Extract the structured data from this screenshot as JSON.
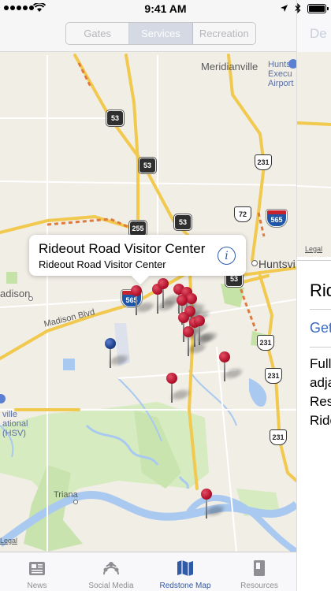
{
  "status_bar": {
    "time": "9:41 AM"
  },
  "segmented": {
    "items": [
      "Gates",
      "Services",
      "Recreation"
    ],
    "selected": "Services"
  },
  "nav": {
    "right_ghost": "De"
  },
  "map": {
    "labels": [
      "Meridianville",
      "Huntsville Executive Airport",
      "Huntsville",
      "Madison",
      "Madison Blvd",
      "Triana",
      "Huntsville International (HSV)"
    ],
    "label_fragments": {
      "huntsville_1": "Hunts",
      "huntsville_2": "Execu",
      "huntsville_3": "Airport",
      "huntsville_city": "Huntsvi",
      "madison": "adison",
      "hsv_1": "ville",
      "hsv_2": "ational",
      "hsv_3": "(HSV)"
    },
    "legal": "Legal",
    "shields": {
      "us53_a": "53",
      "us53_b": "53",
      "state255": "255",
      "state53": "53",
      "state53_b": "53",
      "us231_a": "231",
      "us231_b": "231",
      "us231_c": "231",
      "us231_d": "231",
      "us72": "72",
      "i565_a": "565",
      "i565_b": "565"
    }
  },
  "callout": {
    "title": "Rideout Road Visitor Center",
    "subtitle": "Rideout Road Visitor Center",
    "info_icon": "i"
  },
  "detail": {
    "legal": "Legal",
    "title": "Rid",
    "link": "Get",
    "text_lines": [
      "Full",
      "adja",
      "Res",
      "Ride"
    ]
  },
  "tabs": [
    {
      "label": "News",
      "icon": "news-icon"
    },
    {
      "label": "Social Media",
      "icon": "social-media-icon"
    },
    {
      "label": "Redstone Map",
      "icon": "map-icon",
      "active": true
    },
    {
      "label": "Resources",
      "icon": "resources-icon"
    }
  ],
  "colors": {
    "accent": "#2f5aa8",
    "pin_red": "#b3122c",
    "pin_blue": "#1e3f8a",
    "interstate": "#1e56a8",
    "road_yellow": "#f1c94f",
    "park_green": "#c5e3a6",
    "water": "#a9c9f0"
  }
}
